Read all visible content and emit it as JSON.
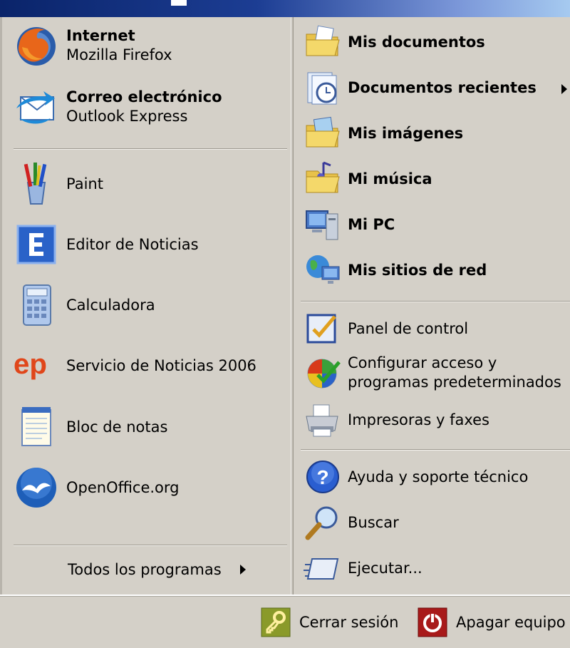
{
  "left_pinned": [
    {
      "title": "Internet",
      "subtitle": "Mozilla Firefox",
      "icon": "firefox-icon"
    },
    {
      "title": "Correo electrónico",
      "subtitle": "Outlook Express",
      "icon": "outlook-express-icon"
    }
  ],
  "left_recent": [
    {
      "label": "Paint",
      "icon": "paint-icon"
    },
    {
      "label": "Editor de Noticias",
      "icon": "editor-e-icon"
    },
    {
      "label": "Calculadora",
      "icon": "calculator-icon"
    },
    {
      "label": "Servicio de Noticias 2006",
      "icon": "ep-logo-icon"
    },
    {
      "label": "Bloc de notas",
      "icon": "notepad-icon"
    },
    {
      "label": "OpenOffice.org",
      "icon": "openoffice-icon"
    }
  ],
  "all_programs": "Todos los programas",
  "right_places": [
    {
      "label": "Mis documentos",
      "icon": "folder-documents-icon"
    },
    {
      "label": "Documentos recientes",
      "icon": "recent-documents-icon"
    },
    {
      "label": "Mis imágenes",
      "icon": "folder-pictures-icon"
    },
    {
      "label": "Mi música",
      "icon": "folder-music-icon"
    },
    {
      "label": "Mi PC",
      "icon": "computer-icon"
    },
    {
      "label": "Mis sitios de red",
      "icon": "network-icon"
    }
  ],
  "right_system": [
    {
      "label": "Panel de control",
      "icon": "control-panel-icon"
    },
    {
      "label": "Configurar acceso y",
      "label2": "programas predeterminados",
      "icon": "program-access-icon"
    },
    {
      "label": "Impresoras y faxes",
      "icon": "printer-icon"
    }
  ],
  "right_tools": [
    {
      "label": "Ayuda y soporte técnico",
      "icon": "help-icon"
    },
    {
      "label": "Buscar",
      "icon": "search-icon"
    },
    {
      "label": "Ejecutar...",
      "icon": "run-icon"
    }
  ],
  "bottom": {
    "logoff": "Cerrar sesión",
    "shutdown": "Apagar equipo"
  },
  "colors": {
    "menu_bg": "#d4d0c8",
    "title_start": "#0a246a",
    "title_end": "#a6caf0"
  }
}
